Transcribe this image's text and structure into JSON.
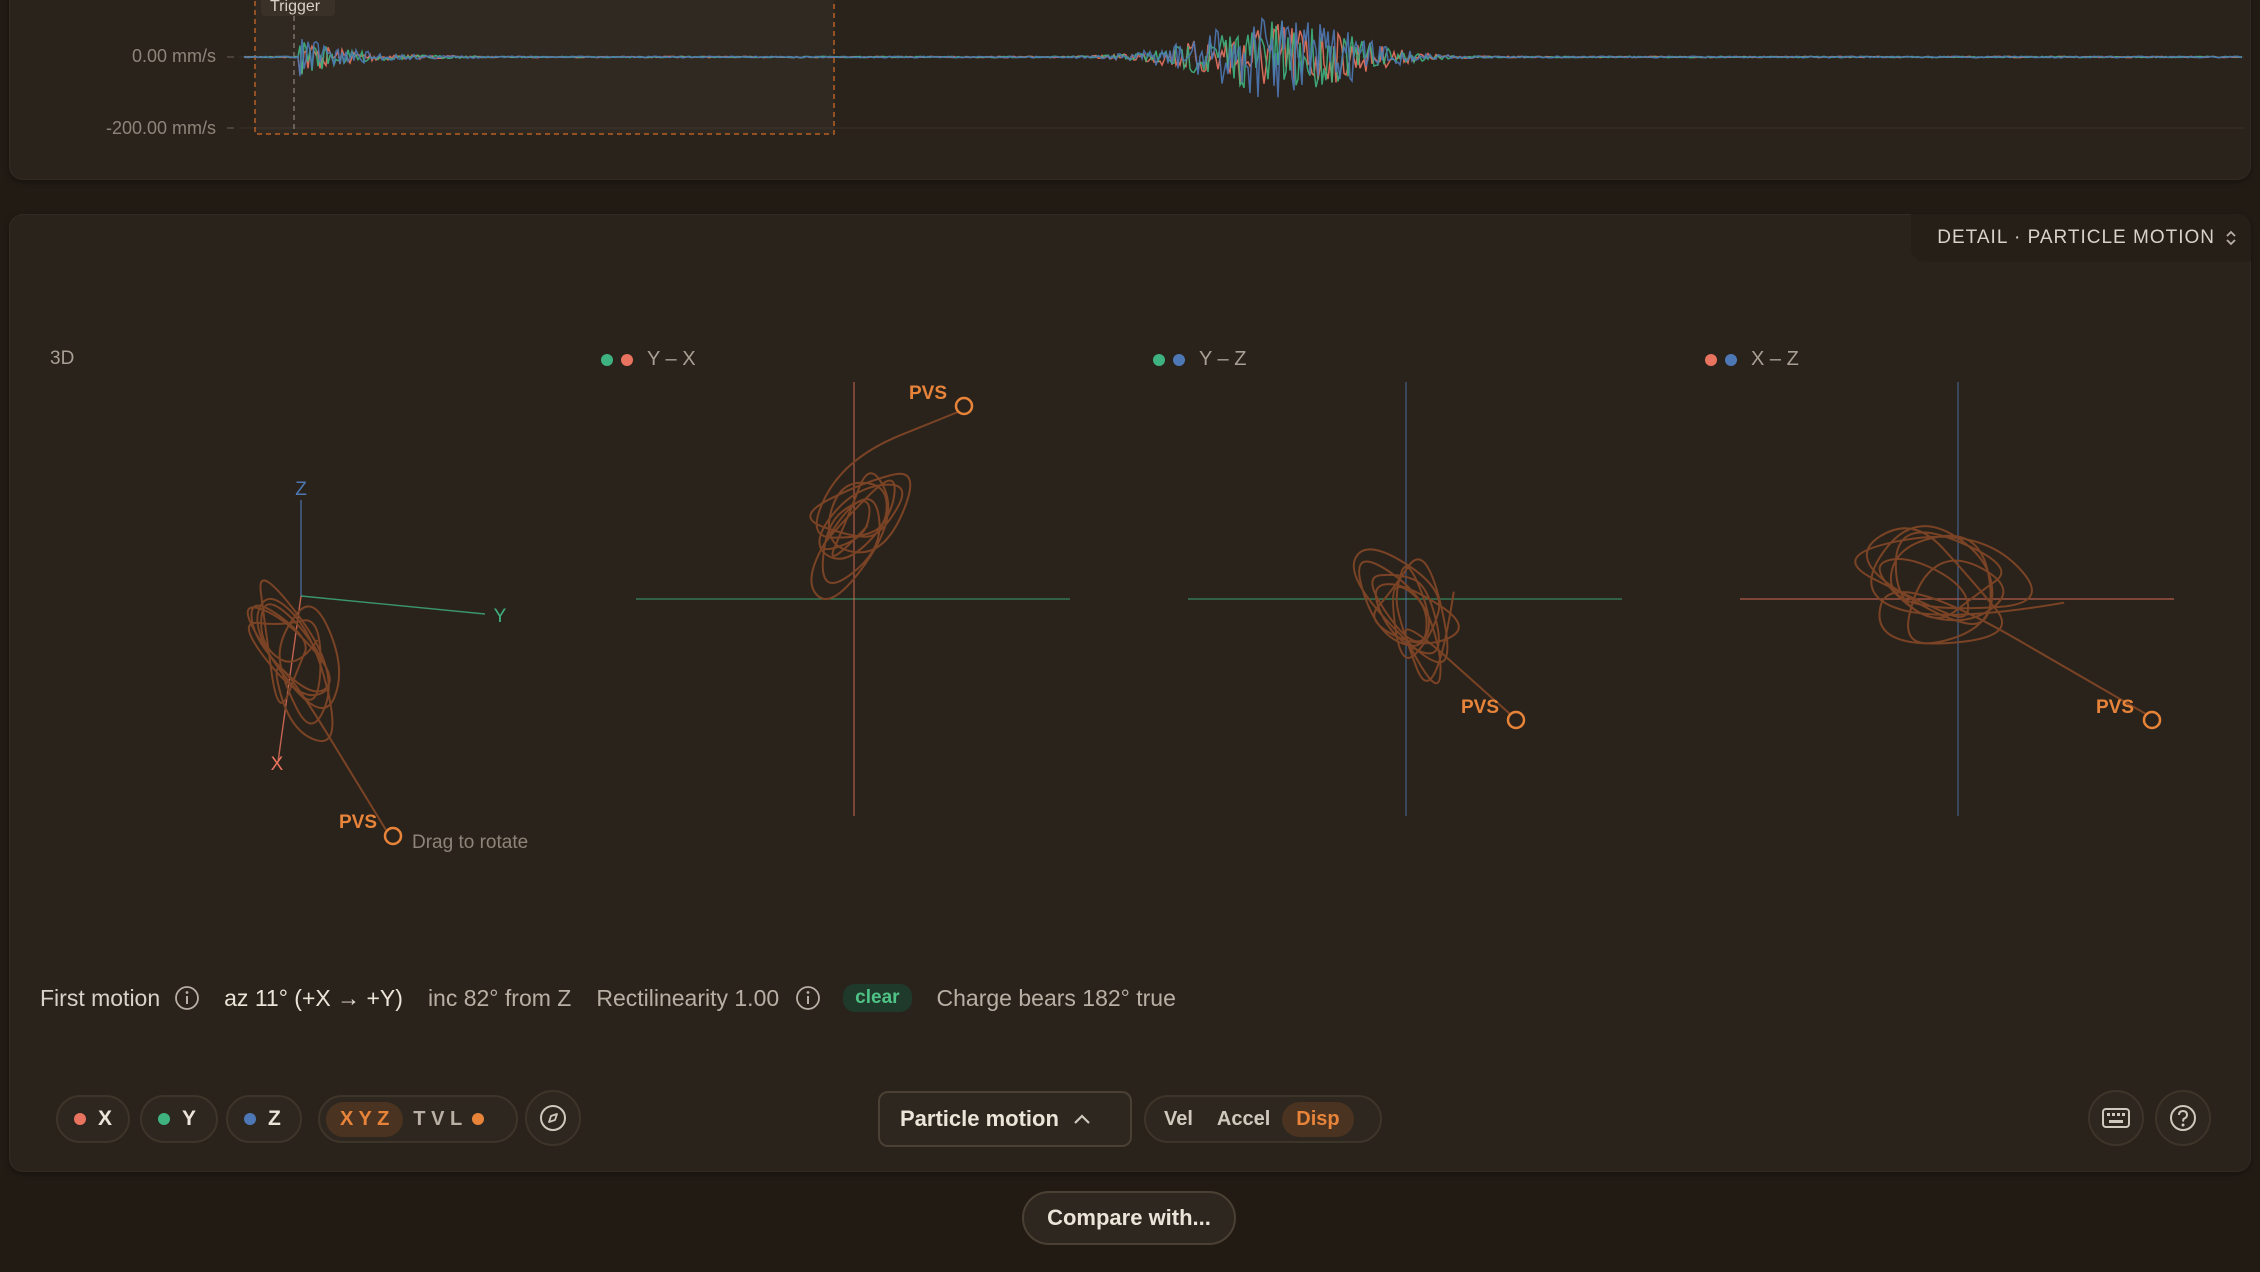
{
  "overview": {
    "trigger_label": "Trigger",
    "y_ticks": [
      "0.00 mm/s",
      "-200.00 mm/s"
    ]
  },
  "detail": {
    "mode_label": "DETAIL · PARTICLE MOTION",
    "plots": {
      "p3d": {
        "title": "3D",
        "axis_z": "Z",
        "axis_y": "Y",
        "axis_x": "X",
        "pvs_label": "PVS",
        "hint": "Drag to rotate"
      },
      "yx": {
        "title": "Y – X",
        "pvs_label": "PVS"
      },
      "yz": {
        "title": "Y – Z",
        "pvs_label": "PVS"
      },
      "xz": {
        "title": "X – Z",
        "pvs_label": "PVS"
      }
    },
    "first_motion": {
      "label": "First motion",
      "azimuth": "az 11° (+X → +Y)",
      "inclination": "inc 82° from Z",
      "rectilinearity": "Rectilinearity 1.00",
      "badge": "clear",
      "bearing": "Charge bears 182° true"
    }
  },
  "toolbar": {
    "channels": [
      {
        "label": "X",
        "color": "#e8735f"
      },
      {
        "label": "Y",
        "color": "#3fb37f"
      },
      {
        "label": "Z",
        "color": "#4e78b5"
      }
    ],
    "frame_xyz": "X Y Z",
    "frame_tvl": "T V L",
    "view_label": "Particle motion",
    "units": [
      "Vel",
      "Accel",
      "Disp"
    ],
    "units_active": "Disp"
  },
  "compare_label": "Compare with...",
  "colors": {
    "accent": "#e8843a",
    "trace": "#7a4325",
    "x_channel": "#e8735f",
    "y_channel": "#3fb37f",
    "z_channel": "#4e78b5"
  }
}
